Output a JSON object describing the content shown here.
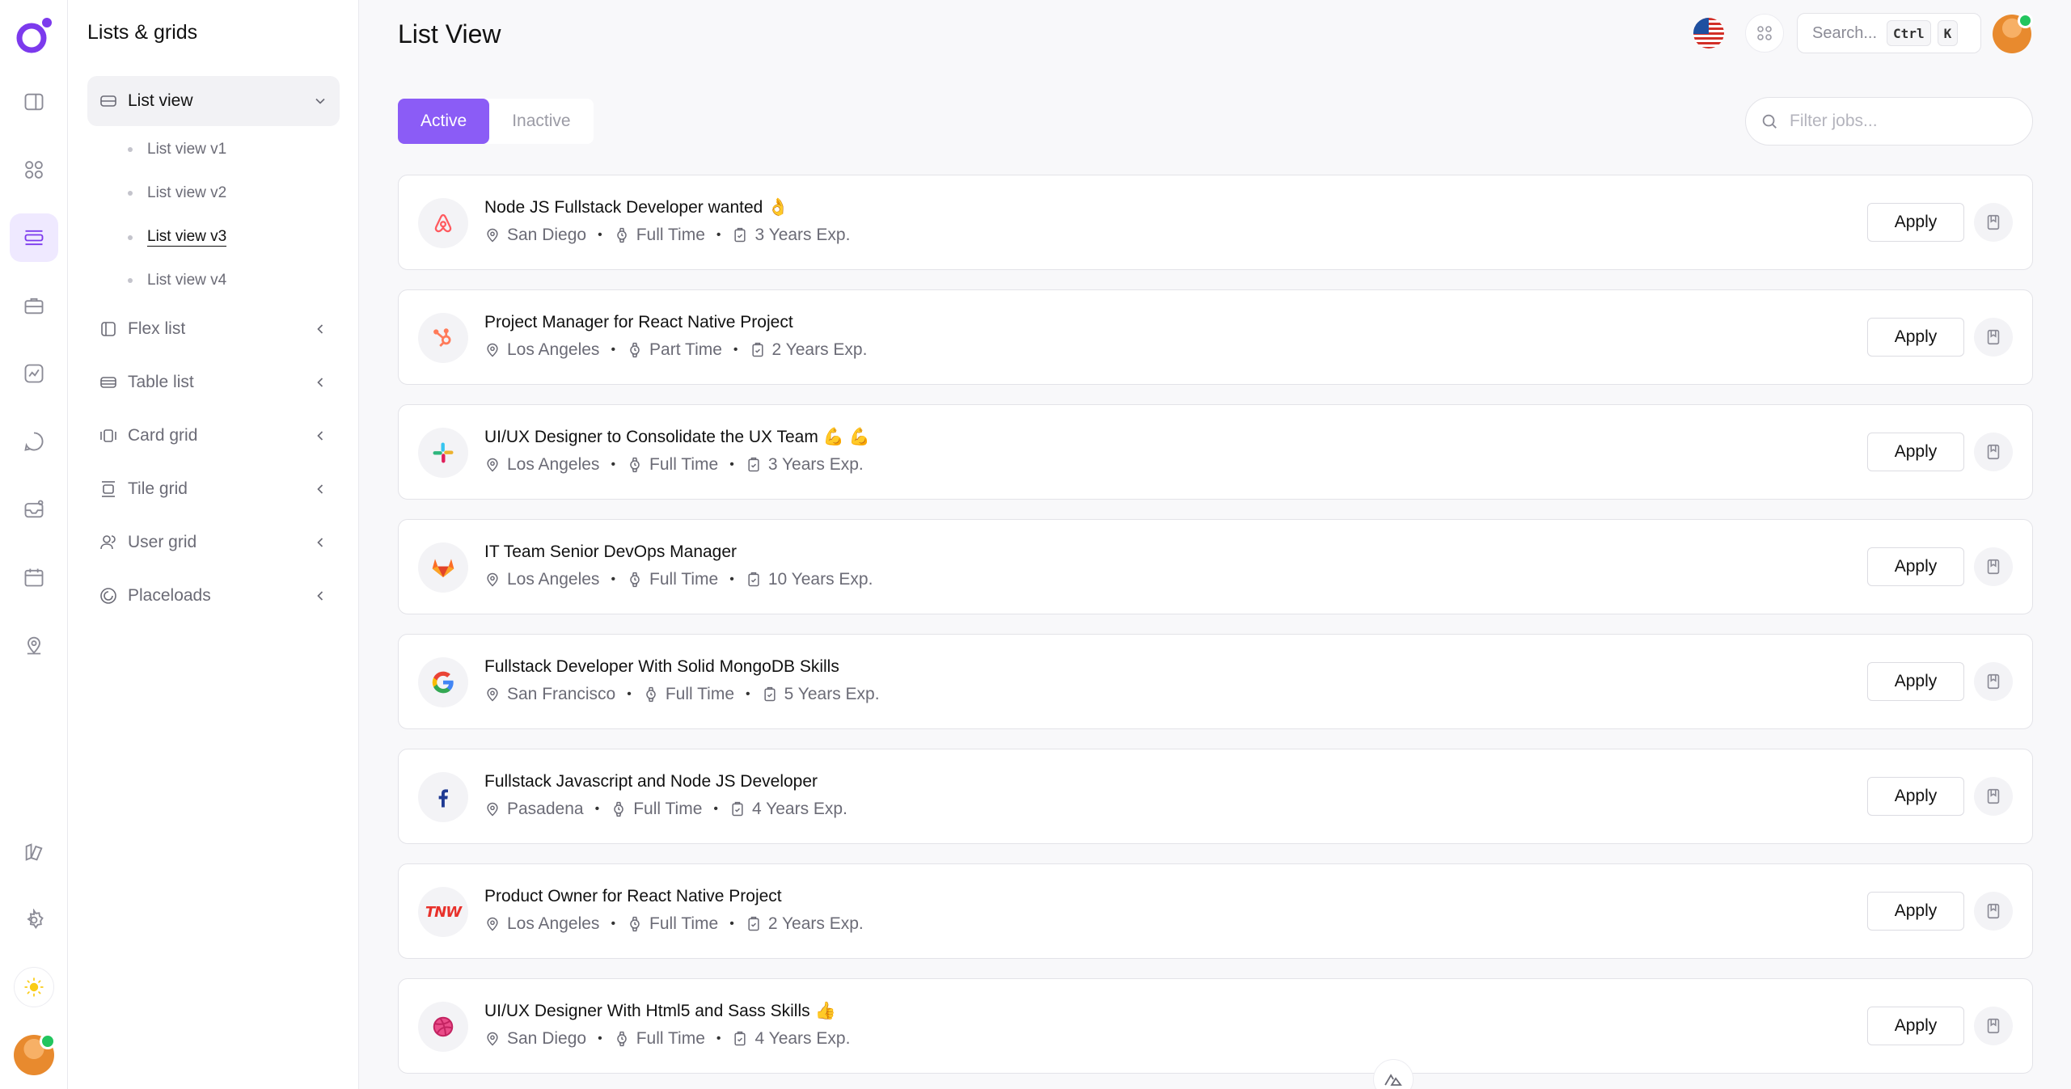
{
  "sidebar": {
    "title": "Lists & grids",
    "items": [
      {
        "label": "List view",
        "icon": "list-view-icon",
        "open": true
      },
      {
        "label": "Flex list",
        "icon": "flex-list-icon"
      },
      {
        "label": "Table list",
        "icon": "table-list-icon"
      },
      {
        "label": "Card grid",
        "icon": "card-grid-icon"
      },
      {
        "label": "Tile grid",
        "icon": "tile-grid-icon"
      },
      {
        "label": "User grid",
        "icon": "user-grid-icon"
      },
      {
        "label": "Placeloads",
        "icon": "placeloads-icon"
      }
    ],
    "sub_items": [
      {
        "label": "List view v1"
      },
      {
        "label": "List view v2"
      },
      {
        "label": "List view v3",
        "active": true
      },
      {
        "label": "List view v4"
      }
    ]
  },
  "header": {
    "title": "List View",
    "search_placeholder": "Search...",
    "kbd_ctrl": "Ctrl",
    "kbd_k": "K"
  },
  "tabs": [
    {
      "label": "Active",
      "active": true
    },
    {
      "label": "Inactive"
    }
  ],
  "filter": {
    "placeholder": "Filter jobs..."
  },
  "jobs": [
    {
      "title": "Node JS Fullstack Developer wanted 👌",
      "location": "San Diego",
      "type": "Full Time",
      "exp": "3 Years Exp.",
      "logo": "airbnb-logo"
    },
    {
      "title": "Project Manager for React Native Project",
      "location": "Los Angeles",
      "type": "Part Time",
      "exp": "2 Years Exp.",
      "logo": "hubspot-logo"
    },
    {
      "title": "UI/UX Designer to Consolidate the UX Team 💪 💪",
      "location": "Los Angeles",
      "type": "Full Time",
      "exp": "3 Years Exp.",
      "logo": "slack-logo"
    },
    {
      "title": "IT Team Senior DevOps Manager",
      "location": "Los Angeles",
      "type": "Full Time",
      "exp": "10 Years Exp.",
      "logo": "gitlab-logo"
    },
    {
      "title": "Fullstack Developer With Solid MongoDB Skills",
      "location": "San Francisco",
      "type": "Full Time",
      "exp": "5 Years Exp.",
      "logo": "google-logo"
    },
    {
      "title": "Fullstack Javascript and Node JS Developer",
      "location": "Pasadena",
      "type": "Full Time",
      "exp": "4 Years Exp.",
      "logo": "facebook-logo"
    },
    {
      "title": "Product Owner for React Native Project",
      "location": "Los Angeles",
      "type": "Full Time",
      "exp": "2 Years Exp.",
      "logo": "tnw-logo"
    },
    {
      "title": "UI/UX Designer With Html5 and Sass Skills 👍",
      "location": "San Diego",
      "type": "Full Time",
      "exp": "4 Years Exp.",
      "logo": "dribbble-logo"
    }
  ],
  "apply_label": "Apply",
  "logo_text": {
    "tnw": "TNW"
  },
  "colors": {
    "accent": "#8b5cf6",
    "accent_soft": "#efe9ff"
  }
}
